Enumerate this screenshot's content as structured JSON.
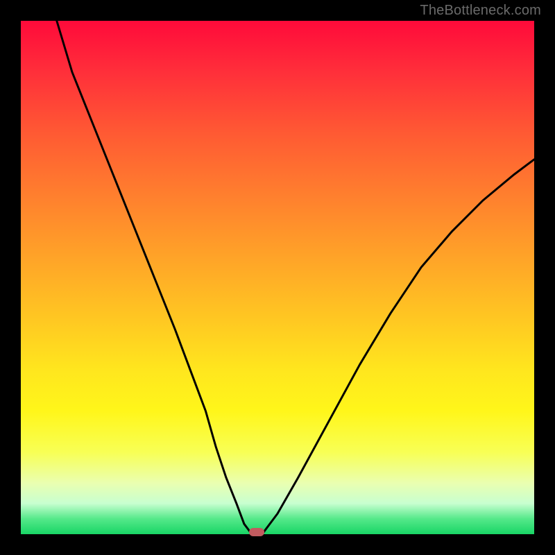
{
  "watermark": "TheBottleneck.com",
  "colors": {
    "frame": "#000000",
    "curve": "#000000",
    "marker": "#c15b5f",
    "gradient_stops": [
      {
        "pos": 0,
        "hex": "#ff0a3a"
      },
      {
        "pos": 10,
        "hex": "#ff2f3a"
      },
      {
        "pos": 22,
        "hex": "#ff5a33"
      },
      {
        "pos": 34,
        "hex": "#ff7f2e"
      },
      {
        "pos": 46,
        "hex": "#ffa328"
      },
      {
        "pos": 58,
        "hex": "#ffc722"
      },
      {
        "pos": 68,
        "hex": "#ffe61e"
      },
      {
        "pos": 76,
        "hex": "#fff61a"
      },
      {
        "pos": 84,
        "hex": "#f8ff55"
      },
      {
        "pos": 90,
        "hex": "#eaffb0"
      },
      {
        "pos": 94,
        "hex": "#c8ffd0"
      },
      {
        "pos": 97,
        "hex": "#55e98a"
      },
      {
        "pos": 100,
        "hex": "#18d565"
      }
    ]
  },
  "chart_data": {
    "type": "line",
    "title": "",
    "xlabel": "",
    "ylabel": "",
    "xlim": [
      0,
      100
    ],
    "ylim": [
      0,
      100
    ],
    "grid": false,
    "legend": false,
    "series": [
      {
        "name": "bottleneck-curve",
        "x": [
          7,
          10,
          14,
          18,
          22,
          26,
          30,
          33,
          36,
          38,
          40,
          42,
          43.5,
          45,
          47,
          50,
          54,
          60,
          66,
          72,
          78,
          84,
          90,
          96,
          100
        ],
        "y": [
          100,
          90,
          80,
          70,
          60,
          50,
          40,
          32,
          24,
          17,
          11,
          6,
          2,
          0,
          0,
          4,
          11,
          22,
          33,
          43,
          52,
          59,
          65,
          70,
          73
        ]
      }
    ],
    "marker": {
      "x": 46,
      "y": 0,
      "shape": "pill",
      "color": "#c15b5f"
    }
  }
}
